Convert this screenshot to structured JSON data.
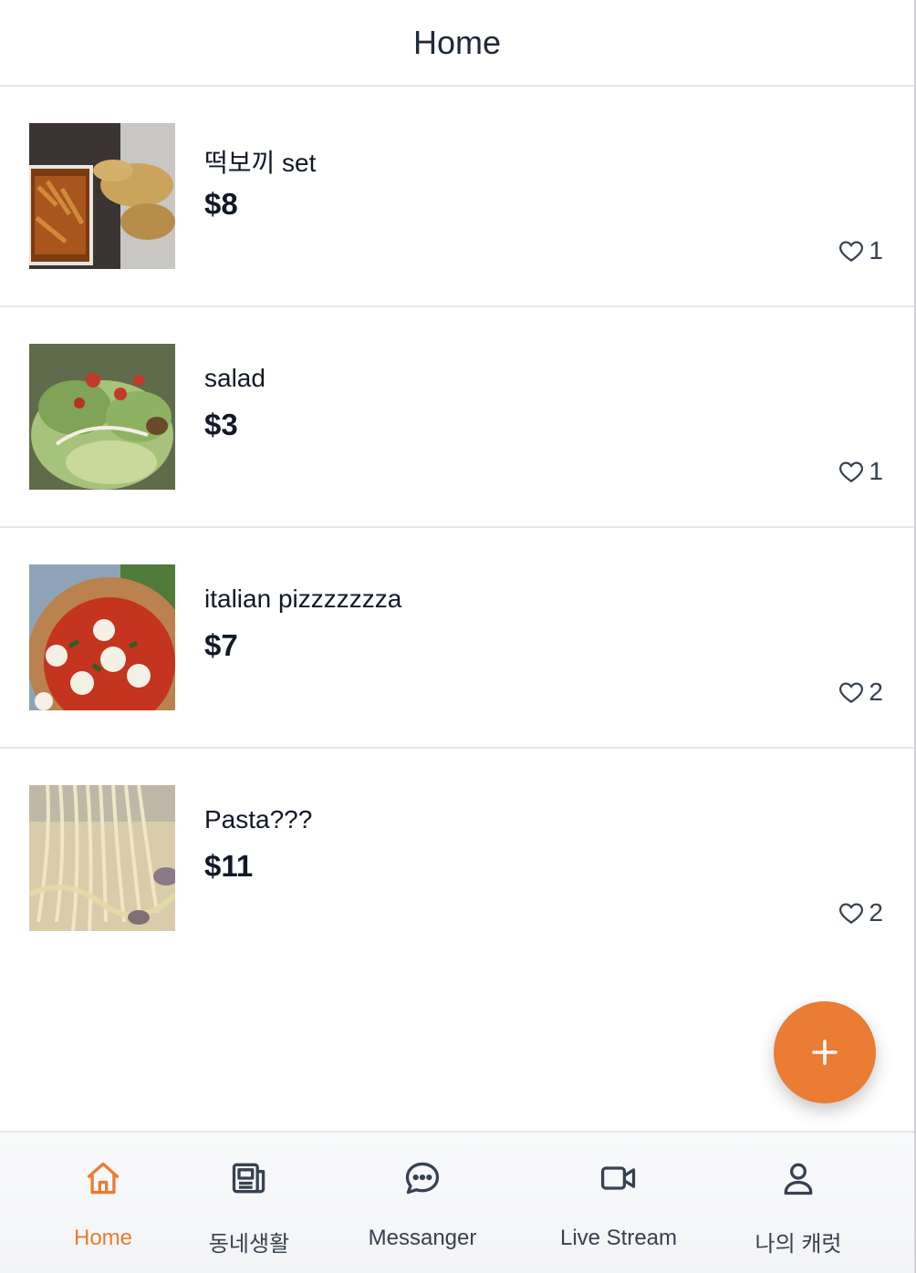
{
  "header": {
    "title": "Home"
  },
  "products": [
    {
      "title": "떡보끼 set",
      "price": "$8",
      "likes": "1",
      "image": "tteokbokki-photo"
    },
    {
      "title": "salad",
      "price": "$3",
      "likes": "1",
      "image": "salad-photo"
    },
    {
      "title": "italian pizzzzzzza",
      "price": "$7",
      "likes": "2",
      "image": "pizza-photo"
    },
    {
      "title": "Pasta???",
      "price": "$11",
      "likes": "2",
      "image": "pasta-photo"
    }
  ],
  "fab": {
    "icon": "plus-icon",
    "color": "#ea7c33"
  },
  "nav": {
    "items": [
      {
        "label": "Home",
        "icon": "home-icon",
        "active": true
      },
      {
        "label": "동네생활",
        "icon": "newspaper-icon"
      },
      {
        "label": "Messanger",
        "icon": "chat-bubble-icon"
      },
      {
        "label": "Live Stream",
        "icon": "video-camera-icon"
      },
      {
        "label": "나의 캐럿",
        "icon": "user-icon"
      }
    ]
  },
  "colors": {
    "accent": "#ea7c33",
    "text": "#111827",
    "muted": "#374151",
    "divider": "#e5e7eb"
  }
}
